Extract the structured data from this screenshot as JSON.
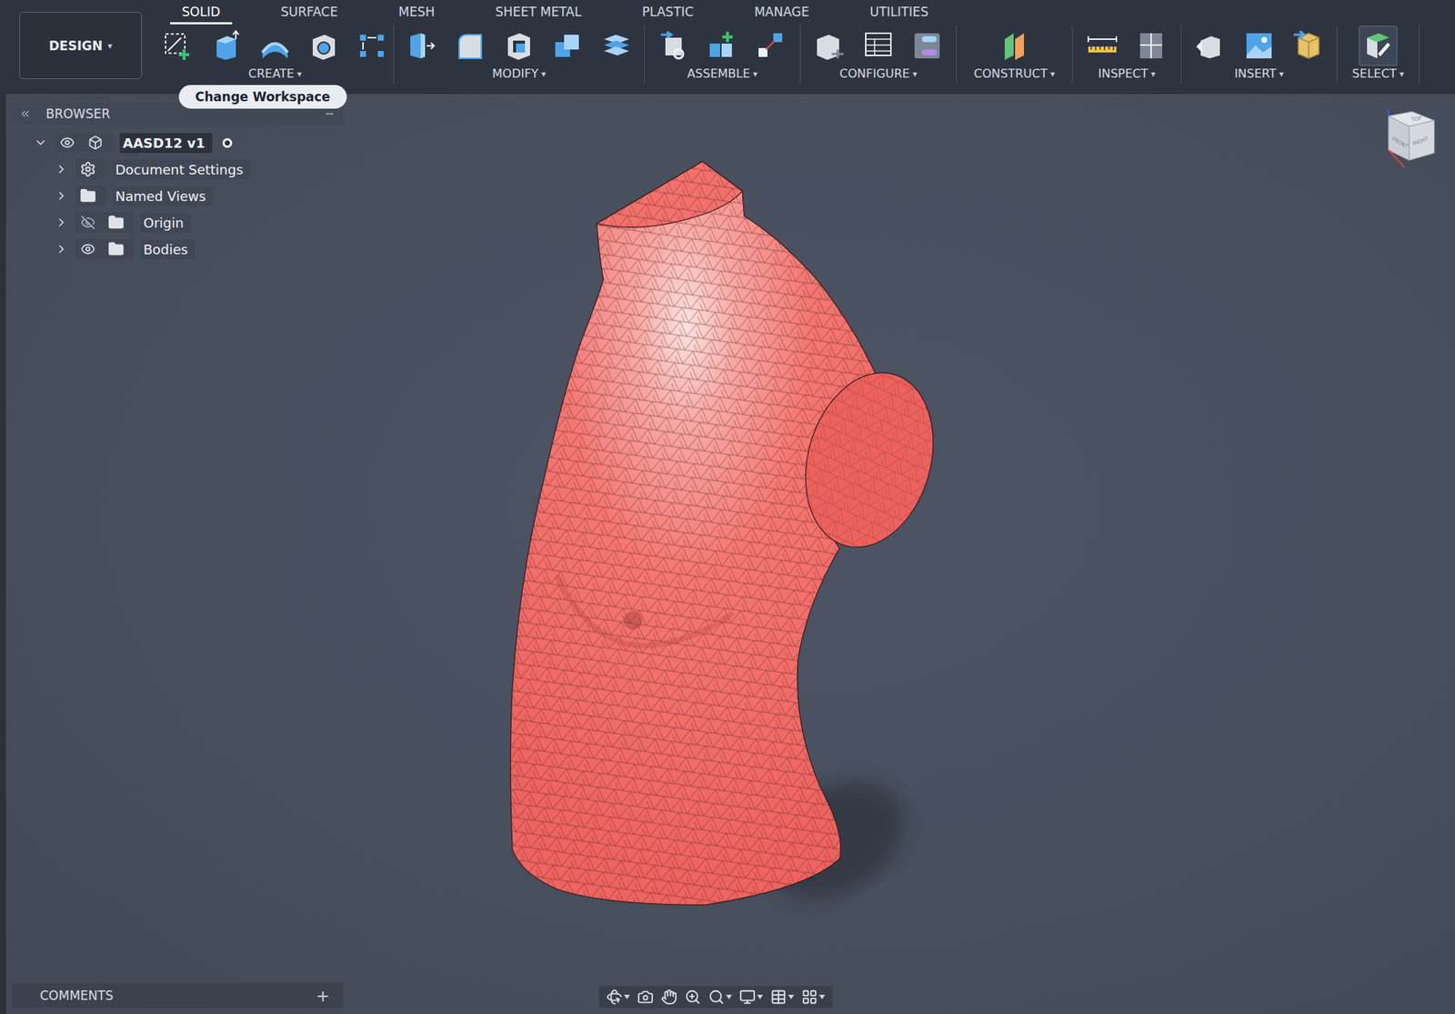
{
  "workspace": {
    "label": "DESIGN",
    "caret": "▾"
  },
  "tooltip": {
    "text": "Change Workspace"
  },
  "tabs": [
    {
      "label": "SOLID",
      "selected": true
    },
    {
      "label": "SURFACE",
      "selected": false
    },
    {
      "label": "MESH",
      "selected": false
    },
    {
      "label": "SHEET METAL",
      "selected": false
    },
    {
      "label": "PLASTIC",
      "selected": false
    },
    {
      "label": "MANAGE",
      "selected": false
    },
    {
      "label": "UTILITIES",
      "selected": false
    }
  ],
  "groups": [
    {
      "label": "CREATE",
      "caret": "▾"
    },
    {
      "label": "MODIFY",
      "caret": "▾"
    },
    {
      "label": "ASSEMBLE",
      "caret": "▾"
    },
    {
      "label": "CONFIGURE",
      "caret": "▾"
    },
    {
      "label": "CONSTRUCT",
      "caret": "▾"
    },
    {
      "label": "INSPECT",
      "caret": "▾"
    },
    {
      "label": "INSERT",
      "caret": "▾"
    },
    {
      "label": "SELECT",
      "caret": "▾"
    }
  ],
  "browser": {
    "title": "BROWSER",
    "items": [
      {
        "label": "AASD12 v1",
        "kind": "component",
        "expanded": true,
        "visible": true,
        "active": true
      },
      {
        "label": "Document Settings",
        "kind": "settings",
        "expanded": false
      },
      {
        "label": "Named Views",
        "kind": "folder",
        "expanded": false
      },
      {
        "label": "Origin",
        "kind": "folder",
        "expanded": false,
        "visible": false
      },
      {
        "label": "Bodies",
        "kind": "folder",
        "expanded": false,
        "visible": true
      }
    ]
  },
  "viewcube": {
    "labels": [
      "TOP",
      "FRONT",
      "RIGHT"
    ]
  },
  "comments": {
    "label": "COMMENTS",
    "add": "+"
  }
}
